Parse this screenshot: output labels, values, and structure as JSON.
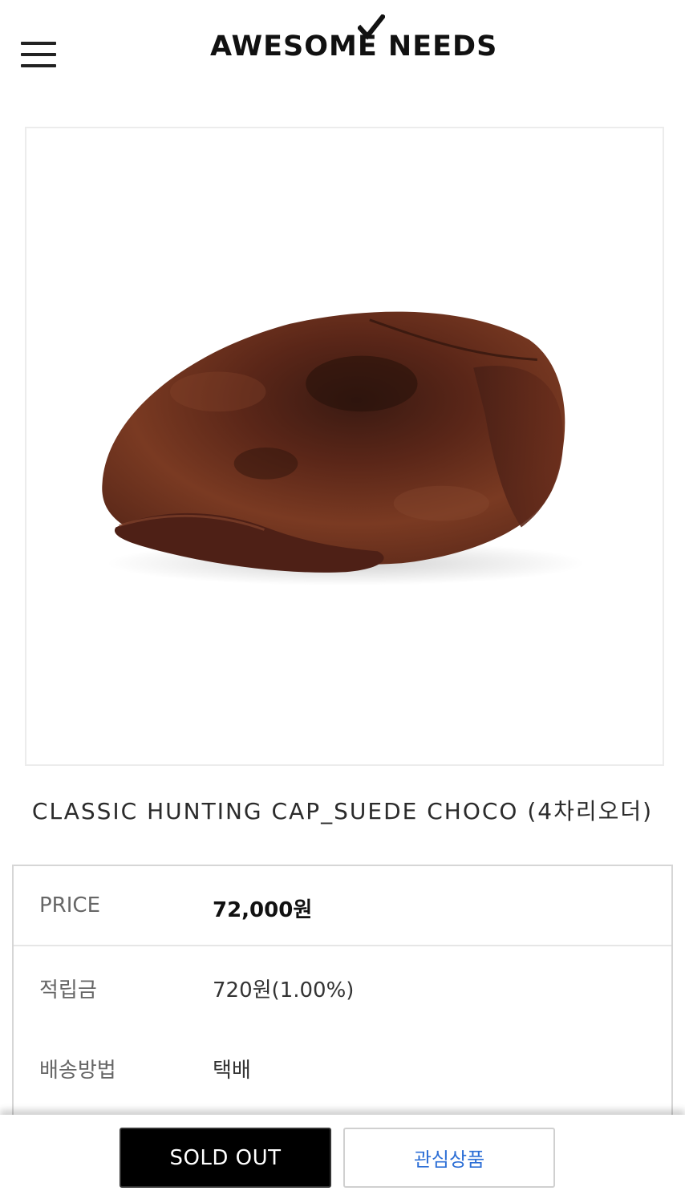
{
  "header": {
    "menu_icon": "hamburger-menu-icon",
    "logo_text": "AWESOME NEEDS",
    "logo_mark": "checkmark-icon"
  },
  "product": {
    "image_alt": "brown suede hunting cap",
    "title": "CLASSIC HUNTING CAP_SUEDE CHOCO (4차리오더)"
  },
  "info": {
    "price_label": "PRICE",
    "price_value": "72,000원",
    "points_label": "적립금",
    "points_value": "720원(1.00%)",
    "shipping_label": "배송방법",
    "shipping_value": "택배"
  },
  "actions": {
    "soldout_label": "SOLD OUT",
    "wishlist_label": "관심상품"
  },
  "colors": {
    "accent_blue": "#2d6fd6",
    "soldout_bg": "#000000",
    "cap_brown": "#6b2f1e"
  }
}
